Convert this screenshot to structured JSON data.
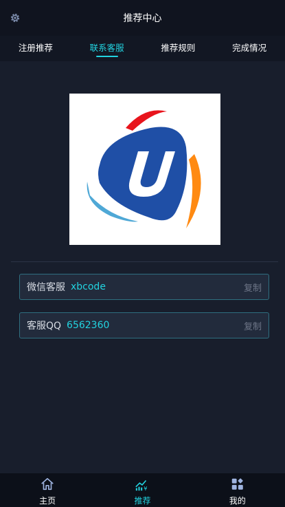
{
  "header": {
    "title": "推荐中心",
    "settings_icon": "gear-icon"
  },
  "tabs": [
    {
      "label": "注册推荐",
      "active": false
    },
    {
      "label": "联系客服",
      "active": true
    },
    {
      "label": "推荐规则",
      "active": false
    },
    {
      "label": "完成情况",
      "active": false
    }
  ],
  "logo": {
    "letter": "U",
    "icon": "u-brand-logo"
  },
  "contacts": [
    {
      "label": "微信客服",
      "value": "xbcode",
      "copy_label": "复制"
    },
    {
      "label": "客服QQ",
      "value": "6562360",
      "copy_label": "复制"
    }
  ],
  "bottom_nav": [
    {
      "label": "主页",
      "icon": "home-icon",
      "active": false
    },
    {
      "label": "推荐",
      "icon": "chart-yen-icon",
      "active": true
    },
    {
      "label": "我的",
      "icon": "grid-icon",
      "active": false
    }
  ],
  "colors": {
    "accent": "#22d3e0",
    "background": "#181e2c",
    "header": "#10141f"
  }
}
